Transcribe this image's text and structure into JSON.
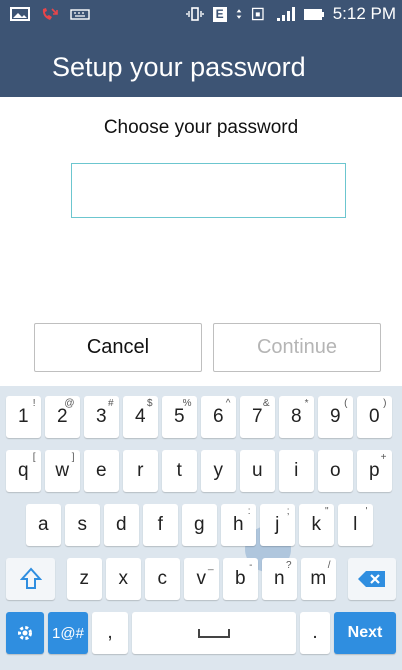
{
  "status": {
    "time": "5:12 PM",
    "network": "E"
  },
  "app_bar": {
    "title": "Setup your password"
  },
  "prompt": "Choose your password",
  "password_input": {
    "value": ""
  },
  "buttons": {
    "cancel": "Cancel",
    "continue": "Continue"
  },
  "keyboard": {
    "number_row": [
      {
        "k": "1",
        "h": "!"
      },
      {
        "k": "2",
        "h": "@"
      },
      {
        "k": "3",
        "h": "#"
      },
      {
        "k": "4",
        "h": "$"
      },
      {
        "k": "5",
        "h": "%"
      },
      {
        "k": "6",
        "h": "^"
      },
      {
        "k": "7",
        "h": "&"
      },
      {
        "k": "8",
        "h": "*"
      },
      {
        "k": "9",
        "h": "("
      },
      {
        "k": "0",
        "h": ")"
      }
    ],
    "row1": [
      {
        "k": "q",
        "h": "["
      },
      {
        "k": "w",
        "h": "]"
      },
      {
        "k": "e",
        "h": ""
      },
      {
        "k": "r",
        "h": ""
      },
      {
        "k": "t",
        "h": ""
      },
      {
        "k": "y",
        "h": ""
      },
      {
        "k": "u",
        "h": ""
      },
      {
        "k": "i",
        "h": ""
      },
      {
        "k": "o",
        "h": ""
      },
      {
        "k": "p",
        "h": "+"
      }
    ],
    "row2": [
      {
        "k": "a",
        "h": ""
      },
      {
        "k": "s",
        "h": ""
      },
      {
        "k": "d",
        "h": ""
      },
      {
        "k": "f",
        "h": ""
      },
      {
        "k": "g",
        "h": ""
      },
      {
        "k": "h",
        "h": ":"
      },
      {
        "k": "j",
        "h": ";"
      },
      {
        "k": "k",
        "h": "\""
      },
      {
        "k": "l",
        "h": "'"
      }
    ],
    "row3": [
      {
        "k": "z",
        "h": ""
      },
      {
        "k": "x",
        "h": ""
      },
      {
        "k": "c",
        "h": ""
      },
      {
        "k": "v",
        "h": "_"
      },
      {
        "k": "b",
        "h": "-"
      },
      {
        "k": "n",
        "h": "?"
      },
      {
        "k": "m",
        "h": "/"
      }
    ],
    "symbols_label": "1@#",
    "comma": ",",
    "period": ".",
    "next_label": "Next"
  },
  "colors": {
    "app_bar": "#3d5474",
    "accent": "#2f8ee0",
    "input_border": "#6cc6cf"
  }
}
